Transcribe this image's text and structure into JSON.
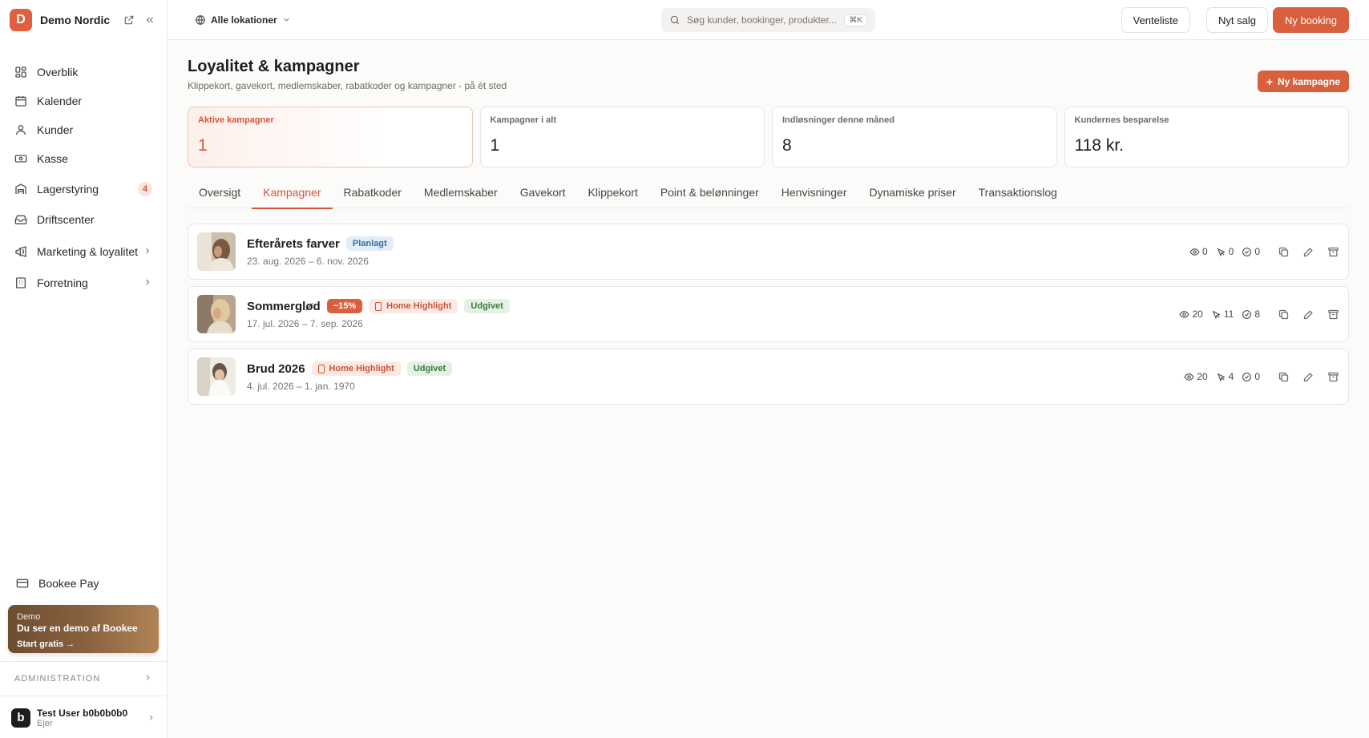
{
  "sidebar": {
    "logo_letter": "D",
    "brand": "Demo Nordic",
    "items": [
      {
        "label": "Overblik"
      },
      {
        "label": "Kalender"
      },
      {
        "label": "Kunder"
      },
      {
        "label": "Kasse"
      },
      {
        "label": "Lagerstyring",
        "badge": "4"
      },
      {
        "label": "Driftscenter"
      },
      {
        "label": "Marketing & loyalitet"
      },
      {
        "label": "Forretning"
      }
    ],
    "pay_label": "Bookee Pay",
    "demo": {
      "tag": "Demo",
      "text": "Du ser en demo af Bookee",
      "cta": "Start gratis"
    },
    "admin_label": "ADMINISTRATION",
    "user": {
      "avatar_letter": "b",
      "name": "Test User b0b0b0b0",
      "role": "Ejer"
    }
  },
  "topbar": {
    "location": "Alle lokationer",
    "search_placeholder": "Søg kunder, bookinger, produkter...",
    "search_kbd": "⌘K",
    "waitlist": "Venteliste",
    "new_sale": "Nyt salg",
    "new_booking": "Ny booking"
  },
  "page": {
    "title": "Loyalitet & kampagner",
    "subtitle": "Klippekort, gavekort, medlemskaber, rabatkoder og kampagner - på ét sted",
    "new_campaign": "Ny kampagne"
  },
  "stats": [
    {
      "label": "Aktive kampagner",
      "value": "1"
    },
    {
      "label": "Kampagner i alt",
      "value": "1"
    },
    {
      "label": "Indløsninger denne måned",
      "value": "8"
    },
    {
      "label": "Kundernes besparelse",
      "value": "118 kr."
    }
  ],
  "tabs": [
    "Oversigt",
    "Kampagner",
    "Rabatkoder",
    "Medlemskaber",
    "Gavekort",
    "Klippekort",
    "Point & belønninger",
    "Henvisninger",
    "Dynamiske priser",
    "Transaktionslog"
  ],
  "active_tab": "Kampagner",
  "campaigns": [
    {
      "name": "Efterårets farver",
      "status": "Planlagt",
      "dates": "23. aug. 2026 – 6. nov. 2026",
      "views": "0",
      "clicks": "0",
      "redemptions": "0"
    },
    {
      "name": "Sommerglød",
      "discount": "−15%",
      "highlight": "Home Highlight",
      "status": "Udgivet",
      "dates": "17. jul. 2026 – 7. sep. 2026",
      "views": "20",
      "clicks": "11",
      "redemptions": "8"
    },
    {
      "name": "Brud 2026",
      "highlight": "Home Highlight",
      "status": "Udgivet",
      "dates": "4. jul. 2026 – 1. jan. 1970",
      "views": "20",
      "clicks": "4",
      "redemptions": "0"
    }
  ],
  "colors": {
    "accent": "#d8603f",
    "planned": "#3a6ea5",
    "published": "#3d7a3f"
  }
}
